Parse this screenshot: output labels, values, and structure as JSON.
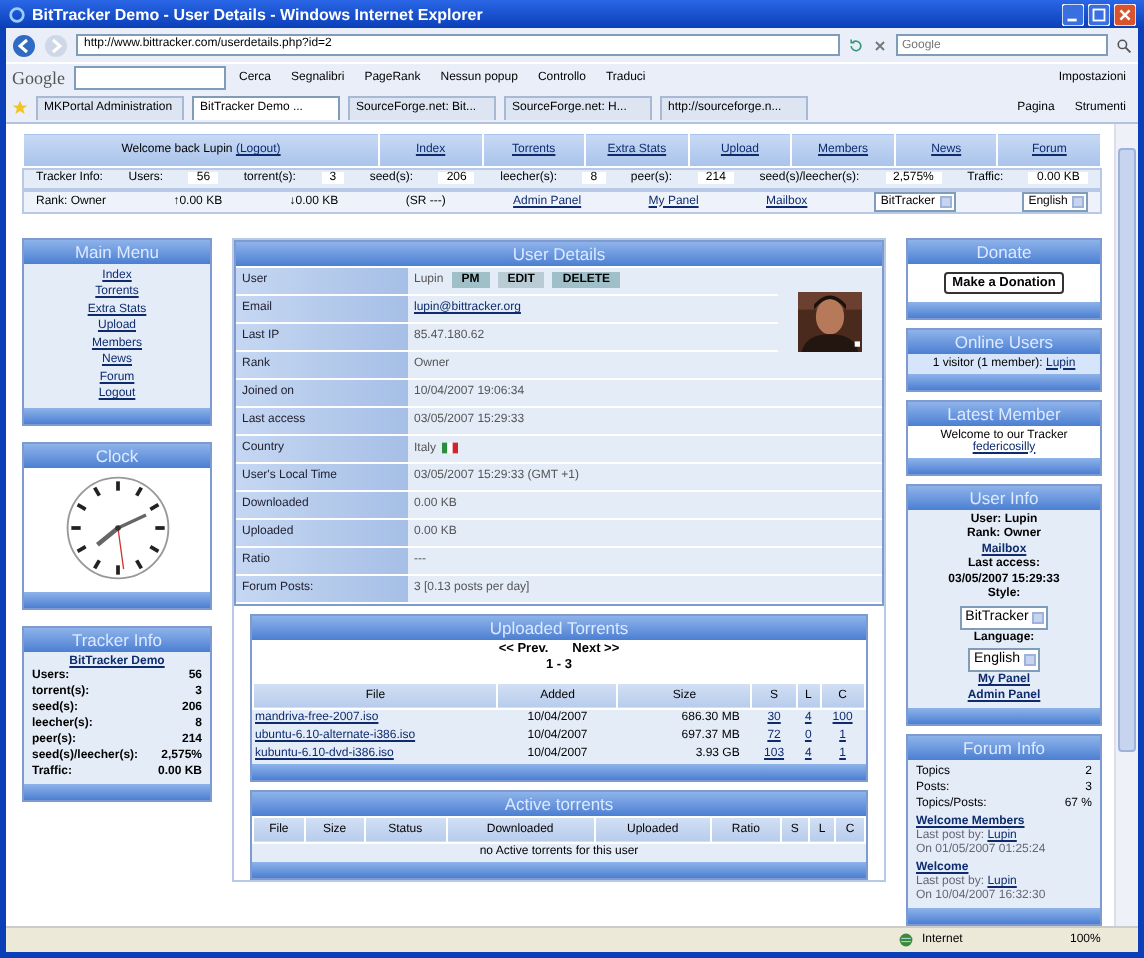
{
  "window": {
    "title": "BitTracker Demo - User Details - Windows Internet Explorer"
  },
  "address_bar": {
    "url": "http://www.bittracker.com/userdetails.php?id=2"
  },
  "search": {
    "placeholder": "Google"
  },
  "google_toolbar": {
    "brand": "Google",
    "search_button": "Cerca",
    "items": [
      "Segnalibri",
      "PageRank",
      "Nessun popup",
      "Controllo",
      "Traduci"
    ],
    "settings": "Impostazioni"
  },
  "browser_tabs": [
    {
      "label": "MKPortal Administration",
      "selected": false
    },
    {
      "label": "BitTracker Demo ...",
      "selected": true
    },
    {
      "label": "SourceForge.net: Bit...",
      "selected": false
    },
    {
      "label": "SourceForge.net: H...",
      "selected": false
    },
    {
      "label": "http://sourceforge.n...",
      "selected": false
    }
  ],
  "command_bar": [
    "Pagina",
    "Strumenti"
  ],
  "nav": {
    "welcome": "Welcome back Lupin",
    "logout": "(Logout)",
    "links": [
      "Index",
      "Torrents",
      "Extra Stats",
      "Upload",
      "Members",
      "News",
      "Forum"
    ]
  },
  "tracker_bar": {
    "label": "Tracker Info:",
    "stats": [
      {
        "label": "Users:",
        "value": "56"
      },
      {
        "label": "torrent(s):",
        "value": "3"
      },
      {
        "label": "seed(s):",
        "value": "206"
      },
      {
        "label": "leecher(s):",
        "value": "8"
      },
      {
        "label": "peer(s):",
        "value": "214"
      },
      {
        "label": "seed(s)/leecher(s):",
        "value": "2,575%"
      },
      {
        "label": "Traffic:",
        "value": "0.00 KB"
      }
    ]
  },
  "user_bar": {
    "rank": "Rank: Owner",
    "uploaded": "↑0.00 KB",
    "downloaded": "↓0.00 KB",
    "share_ratio": "(SR ---)",
    "links": [
      "Admin Panel",
      "My Panel",
      "Mailbox"
    ],
    "style_select": "BitTracker",
    "language_select": "English"
  },
  "main_menu": {
    "title": "Main Menu",
    "links": [
      "Index",
      "Torrents",
      "Extra Stats",
      "Upload",
      "Members",
      "News",
      "Forum",
      "Logout"
    ]
  },
  "clock": {
    "title": "Clock"
  },
  "tracker_info": {
    "title": "Tracker Info",
    "name": "BitTracker Demo",
    "rows": [
      {
        "label": "Users:",
        "value": "56"
      },
      {
        "label": "torrent(s):",
        "value": "3"
      },
      {
        "label": "seed(s):",
        "value": "206"
      },
      {
        "label": "leecher(s):",
        "value": "8"
      },
      {
        "label": "peer(s):",
        "value": "214"
      },
      {
        "label": "seed(s)/leecher(s):",
        "value": "2,575%"
      },
      {
        "label": "Traffic:",
        "value": "0.00 KB"
      }
    ]
  },
  "user_details": {
    "title": "User Details",
    "buttons": [
      "PM",
      "EDIT",
      "DELETE"
    ],
    "rows": [
      {
        "label": "User",
        "value": "Lupin",
        "kind": "user"
      },
      {
        "label": "Email",
        "value": "lupin@bittracker.org",
        "kind": "link"
      },
      {
        "label": "Last IP",
        "value": "85.47.180.62",
        "kind": "text"
      },
      {
        "label": "Rank",
        "value": "Owner",
        "kind": "text"
      },
      {
        "label": "Joined on",
        "value": "10/04/2007 19:06:34",
        "kind": "text"
      },
      {
        "label": "Last access",
        "value": "03/05/2007 15:29:33",
        "kind": "text"
      },
      {
        "label": "Country",
        "value": "Italy",
        "kind": "country"
      },
      {
        "label": "User's Local Time",
        "value": "03/05/2007 15:29:33 (GMT +1)",
        "kind": "text"
      },
      {
        "label": "Downloaded",
        "value": "0.00 KB",
        "kind": "text"
      },
      {
        "label": "Uploaded",
        "value": "0.00 KB",
        "kind": "text"
      },
      {
        "label": "Ratio",
        "value": "---",
        "kind": "text"
      },
      {
        "label": "Forum Posts:",
        "value": "3  [0.13 posts per day]",
        "kind": "text"
      }
    ]
  },
  "uploaded_torrents": {
    "title": "Uploaded Torrents",
    "prev": "<< Prev.",
    "next": "Next >>",
    "range": "1 - 3",
    "columns": [
      "File",
      "Added",
      "Size",
      "S",
      "L",
      "C"
    ],
    "rows": [
      [
        "mandriva-free-2007.iso",
        "10/04/2007",
        "686.30 MB",
        "30",
        "4",
        "100"
      ],
      [
        "ubuntu-6.10-alternate-i386.iso",
        "10/04/2007",
        "697.37 MB",
        "72",
        "0",
        "1"
      ],
      [
        "kubuntu-6.10-dvd-i386.iso",
        "10/04/2007",
        "3.93 GB",
        "103",
        "4",
        "1"
      ]
    ]
  },
  "active_torrents": {
    "title": "Active torrents",
    "columns": [
      "File",
      "Size",
      "Status",
      "Downloaded",
      "Uploaded",
      "Ratio",
      "S",
      "L",
      "C"
    ],
    "empty": "no Active torrents for this user"
  },
  "donate": {
    "title": "Donate",
    "button": "Make a Donation"
  },
  "online_users": {
    "title": "Online Users",
    "text": "1 visitor (1 member):",
    "user": "Lupin"
  },
  "latest_member": {
    "title": "Latest Member",
    "text": "Welcome to our Tracker",
    "member": "federicosilly"
  },
  "user_info": {
    "title": "User Info",
    "user": "User: Lupin",
    "rank": "Rank: Owner",
    "mailbox": "Mailbox",
    "last_access_label": "Last access:",
    "last_access": "03/05/2007 15:29:33",
    "style_label": "Style:",
    "style_select": "BitTracker",
    "language_label": "Language:",
    "language_select": "English",
    "links": [
      "My Panel",
      "Admin Panel"
    ]
  },
  "forum_info": {
    "title": "Forum Info",
    "stats": [
      {
        "label": "Topics",
        "value": "2"
      },
      {
        "label": "Posts:",
        "value": "3"
      },
      {
        "label": "Topics/Posts:",
        "value": "67 %"
      }
    ],
    "posts": [
      {
        "topic": "Welcome Members",
        "last_post_label": "Last post by:",
        "by": "Lupin",
        "on": "On 01/05/2007 01:25:24"
      },
      {
        "topic": "Welcome",
        "last_post_label": "Last post by:",
        "by": "Lupin",
        "on": "On 10/04/2007 16:32:30"
      }
    ]
  },
  "status_bar": {
    "zone": "Internet",
    "zoom": "100%"
  }
}
